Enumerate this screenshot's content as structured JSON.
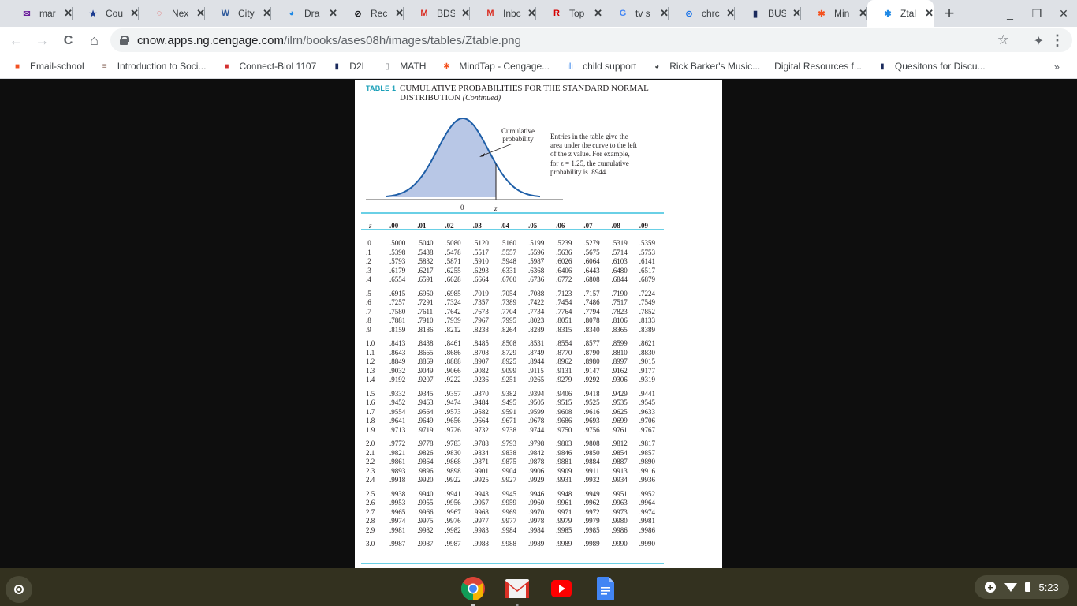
{
  "browser": {
    "tabs": [
      {
        "title": "mar",
        "icon": "mail-icon",
        "color": "#6a1b9a",
        "glyph": "✉"
      },
      {
        "title": "Cou",
        "icon": "shield-star-icon",
        "color": "#1a3a8f",
        "glyph": "★"
      },
      {
        "title": "Nex",
        "icon": "dashed-circle-icon",
        "color": "#e53935",
        "glyph": "◌"
      },
      {
        "title": "City",
        "icon": "word-icon",
        "color": "#2b579a",
        "glyph": "W"
      },
      {
        "title": "Dra",
        "icon": "globe-icon",
        "color": "#1e88e5",
        "glyph": "◕"
      },
      {
        "title": "Rec",
        "icon": "compass-icon",
        "color": "#202124",
        "glyph": "⊘"
      },
      {
        "title": "BDS",
        "icon": "gmail-icon",
        "color": "#d93025",
        "glyph": "M"
      },
      {
        "title": "Inbc",
        "icon": "gmail-icon",
        "color": "#d93025",
        "glyph": "M"
      },
      {
        "title": "Top",
        "icon": "r-logo-icon",
        "color": "#d50000",
        "glyph": "R"
      },
      {
        "title": "tv s",
        "icon": "google-icon",
        "color": "#4285f4",
        "glyph": "G"
      },
      {
        "title": "chrc",
        "icon": "chrome-compass-icon",
        "color": "#1a73e8",
        "glyph": "⊙"
      },
      {
        "title": "BUS",
        "icon": "bookmark-badge-icon",
        "color": "#1a2a5c",
        "glyph": "▮"
      },
      {
        "title": "Min",
        "icon": "mindtap-icon",
        "color": "#f4511e",
        "glyph": "✱"
      },
      {
        "title": "Ztal",
        "icon": "mindtap-icon",
        "color": "#1e88e5",
        "glyph": "✱",
        "active": true
      }
    ],
    "new_tab_label": "+",
    "window_controls": {
      "minimize": "_",
      "restore": "❐",
      "close": "✕"
    },
    "nav": {
      "back": "←",
      "forward": "→",
      "reload": "C",
      "home": "⌂"
    },
    "url_host": "cnow.apps.ng.cengage.com",
    "url_path": "/ilrn/books/ases08h/images/tables/Ztable.png",
    "bookmarks": [
      {
        "label": "Email-school",
        "icon": "microsoft-icon"
      },
      {
        "label": "Introduction to Soci...",
        "icon": "books-icon"
      },
      {
        "label": "Connect-Biol 1107",
        "icon": "mcgraw-hill-icon"
      },
      {
        "label": "D2L",
        "icon": "bookmark-badge-icon"
      },
      {
        "label": "MATH",
        "icon": "document-icon"
      },
      {
        "label": "MindTap - Cengage...",
        "icon": "mindtap-icon"
      },
      {
        "label": "child support",
        "icon": "family-icon"
      },
      {
        "label": "Rick Barker's Music...",
        "icon": "globe-icon"
      },
      {
        "label": "Digital Resources f...",
        "icon": "none"
      },
      {
        "label": "Quesitons for Discu...",
        "icon": "bookmark-badge-icon"
      }
    ],
    "bookmarks_more": "»"
  },
  "document": {
    "table_label": "TABLE 1",
    "title": "CUMULATIVE PROBABILITIES FOR THE STANDARD NORMAL DISTRIBUTION",
    "title_suffix": "(Continued)",
    "curve_label": "Cumulative probability",
    "axis_zero": "0",
    "axis_z": "z",
    "explanation": "Entries in the table give the area under the curve to the left of the z value. For example, for z = 1.25, the cumulative probability is .8944.",
    "accent_color": "#1a9fb8",
    "rule_color": "#6ad0e6",
    "fill_color": "#b8c7e6",
    "curve_color": "#1f5fa8"
  },
  "chart_data": {
    "type": "table",
    "title": "CUMULATIVE PROBABILITIES FOR THE STANDARD NORMAL DISTRIBUTION (Continued)",
    "columns": [
      "z",
      ".00",
      ".01",
      ".02",
      ".03",
      ".04",
      ".05",
      ".06",
      ".07",
      ".08",
      ".09"
    ],
    "groups": [
      [
        [
          ".0",
          ".5000",
          ".5040",
          ".5080",
          ".5120",
          ".5160",
          ".5199",
          ".5239",
          ".5279",
          ".5319",
          ".5359"
        ],
        [
          ".1",
          ".5398",
          ".5438",
          ".5478",
          ".5517",
          ".5557",
          ".5596",
          ".5636",
          ".5675",
          ".5714",
          ".5753"
        ],
        [
          ".2",
          ".5793",
          ".5832",
          ".5871",
          ".5910",
          ".5948",
          ".5987",
          ".6026",
          ".6064",
          ".6103",
          ".6141"
        ],
        [
          ".3",
          ".6179",
          ".6217",
          ".6255",
          ".6293",
          ".6331",
          ".6368",
          ".6406",
          ".6443",
          ".6480",
          ".6517"
        ],
        [
          ".4",
          ".6554",
          ".6591",
          ".6628",
          ".6664",
          ".6700",
          ".6736",
          ".6772",
          ".6808",
          ".6844",
          ".6879"
        ]
      ],
      [
        [
          ".5",
          ".6915",
          ".6950",
          ".6985",
          ".7019",
          ".7054",
          ".7088",
          ".7123",
          ".7157",
          ".7190",
          ".7224"
        ],
        [
          ".6",
          ".7257",
          ".7291",
          ".7324",
          ".7357",
          ".7389",
          ".7422",
          ".7454",
          ".7486",
          ".7517",
          ".7549"
        ],
        [
          ".7",
          ".7580",
          ".7611",
          ".7642",
          ".7673",
          ".7704",
          ".7734",
          ".7764",
          ".7794",
          ".7823",
          ".7852"
        ],
        [
          ".8",
          ".7881",
          ".7910",
          ".7939",
          ".7967",
          ".7995",
          ".8023",
          ".8051",
          ".8078",
          ".8106",
          ".8133"
        ],
        [
          ".9",
          ".8159",
          ".8186",
          ".8212",
          ".8238",
          ".8264",
          ".8289",
          ".8315",
          ".8340",
          ".8365",
          ".8389"
        ]
      ],
      [
        [
          "1.0",
          ".8413",
          ".8438",
          ".8461",
          ".8485",
          ".8508",
          ".8531",
          ".8554",
          ".8577",
          ".8599",
          ".8621"
        ],
        [
          "1.1",
          ".8643",
          ".8665",
          ".8686",
          ".8708",
          ".8729",
          ".8749",
          ".8770",
          ".8790",
          ".8810",
          ".8830"
        ],
        [
          "1.2",
          ".8849",
          ".8869",
          ".8888",
          ".8907",
          ".8925",
          ".8944",
          ".8962",
          ".8980",
          ".8997",
          ".9015"
        ],
        [
          "1.3",
          ".9032",
          ".9049",
          ".9066",
          ".9082",
          ".9099",
          ".9115",
          ".9131",
          ".9147",
          ".9162",
          ".9177"
        ],
        [
          "1.4",
          ".9192",
          ".9207",
          ".9222",
          ".9236",
          ".9251",
          ".9265",
          ".9279",
          ".9292",
          ".9306",
          ".9319"
        ]
      ],
      [
        [
          "1.5",
          ".9332",
          ".9345",
          ".9357",
          ".9370",
          ".9382",
          ".9394",
          ".9406",
          ".9418",
          ".9429",
          ".9441"
        ],
        [
          "1.6",
          ".9452",
          ".9463",
          ".9474",
          ".9484",
          ".9495",
          ".9505",
          ".9515",
          ".9525",
          ".9535",
          ".9545"
        ],
        [
          "1.7",
          ".9554",
          ".9564",
          ".9573",
          ".9582",
          ".9591",
          ".9599",
          ".9608",
          ".9616",
          ".9625",
          ".9633"
        ],
        [
          "1.8",
          ".9641",
          ".9649",
          ".9656",
          ".9664",
          ".9671",
          ".9678",
          ".9686",
          ".9693",
          ".9699",
          ".9706"
        ],
        [
          "1.9",
          ".9713",
          ".9719",
          ".9726",
          ".9732",
          ".9738",
          ".9744",
          ".9750",
          ".9756",
          ".9761",
          ".9767"
        ]
      ],
      [
        [
          "2.0",
          ".9772",
          ".9778",
          ".9783",
          ".9788",
          ".9793",
          ".9798",
          ".9803",
          ".9808",
          ".9812",
          ".9817"
        ],
        [
          "2.1",
          ".9821",
          ".9826",
          ".9830",
          ".9834",
          ".9838",
          ".9842",
          ".9846",
          ".9850",
          ".9854",
          ".9857"
        ],
        [
          "2.2",
          ".9861",
          ".9864",
          ".9868",
          ".9871",
          ".9875",
          ".9878",
          ".9881",
          ".9884",
          ".9887",
          ".9890"
        ],
        [
          "2.3",
          ".9893",
          ".9896",
          ".9898",
          ".9901",
          ".9904",
          ".9906",
          ".9909",
          ".9911",
          ".9913",
          ".9916"
        ],
        [
          "2.4",
          ".9918",
          ".9920",
          ".9922",
          ".9925",
          ".9927",
          ".9929",
          ".9931",
          ".9932",
          ".9934",
          ".9936"
        ]
      ],
      [
        [
          "2.5",
          ".9938",
          ".9940",
          ".9941",
          ".9943",
          ".9945",
          ".9946",
          ".9948",
          ".9949",
          ".9951",
          ".9952"
        ],
        [
          "2.6",
          ".9953",
          ".9955",
          ".9956",
          ".9957",
          ".9959",
          ".9960",
          ".9961",
          ".9962",
          ".9963",
          ".9964"
        ],
        [
          "2.7",
          ".9965",
          ".9966",
          ".9967",
          ".9968",
          ".9969",
          ".9970",
          ".9971",
          ".9972",
          ".9973",
          ".9974"
        ],
        [
          "2.8",
          ".9974",
          ".9975",
          ".9976",
          ".9977",
          ".9977",
          ".9978",
          ".9979",
          ".9979",
          ".9980",
          ".9981"
        ],
        [
          "2.9",
          ".9981",
          ".9982",
          ".9982",
          ".9983",
          ".9984",
          ".9984",
          ".9985",
          ".9985",
          ".9986",
          ".9986"
        ]
      ],
      [
        [
          "3.0",
          ".9987",
          ".9987",
          ".9987",
          ".9988",
          ".9988",
          ".9989",
          ".9989",
          ".9989",
          ".9990",
          ".9990"
        ]
      ]
    ]
  },
  "shelf": {
    "apps": [
      {
        "name": "chrome-icon",
        "running": true
      },
      {
        "name": "gmail-icon",
        "running": true
      },
      {
        "name": "youtube-icon",
        "running": false
      },
      {
        "name": "google-docs-icon",
        "running": false
      }
    ],
    "time": "5:23",
    "background": "#33311f"
  }
}
